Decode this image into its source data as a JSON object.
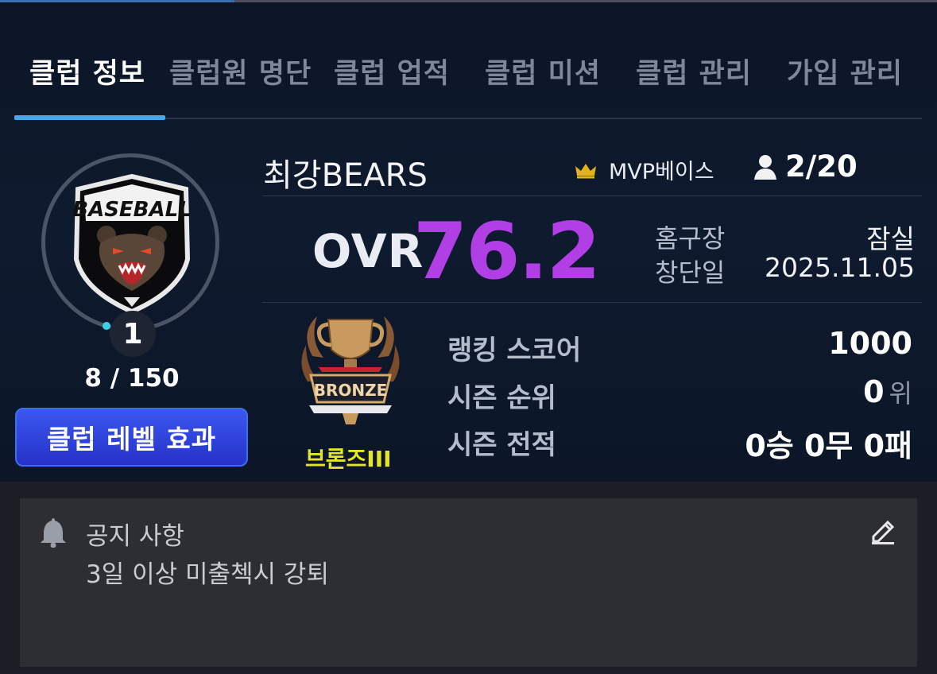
{
  "tabs": [
    {
      "label": "클럽 정보",
      "active": true
    },
    {
      "label": "클럽원 명단",
      "active": false
    },
    {
      "label": "클럽 업적",
      "active": false
    },
    {
      "label": "클럽 미션",
      "active": false
    },
    {
      "label": "클럽 관리",
      "active": false
    },
    {
      "label": "가입 관리",
      "active": false
    }
  ],
  "emblem": {
    "banner_text": "BASEBALL",
    "level": "1",
    "exp_text": "8 / 150",
    "exp_progress": 0.053,
    "icon": "bear-baseball-emblem"
  },
  "level_effect_button": "클럽 레벨 효과",
  "club": {
    "name": "최강BEARS",
    "grade": "MVP베이스",
    "grade_icon": "crown-icon",
    "members": "2/20",
    "members_icon": "person-icon"
  },
  "ovr": {
    "label": "OVR",
    "value": "76.2",
    "color": "#b23ee6"
  },
  "info": {
    "home_label": "홈구장",
    "home_value": "잠실",
    "founded_label": "창단일",
    "founded_value": "2025.11.05"
  },
  "rank": {
    "trophy_banner": "BRONZE",
    "tier": "브론즈III",
    "tier_color": "#e3e624",
    "score_label": "랭킹 스코어",
    "score_value": "1000",
    "season_rank_label": "시즌 순위",
    "season_rank_value": "0",
    "season_rank_unit": "위",
    "record_label": "시즌 전적",
    "record_value": "0승 0무 0패"
  },
  "notice": {
    "title": "공지 사항",
    "body": "3일 이상 미출첵시 강퇴",
    "icon": "bell-icon",
    "edit_icon": "pencil-icon"
  }
}
